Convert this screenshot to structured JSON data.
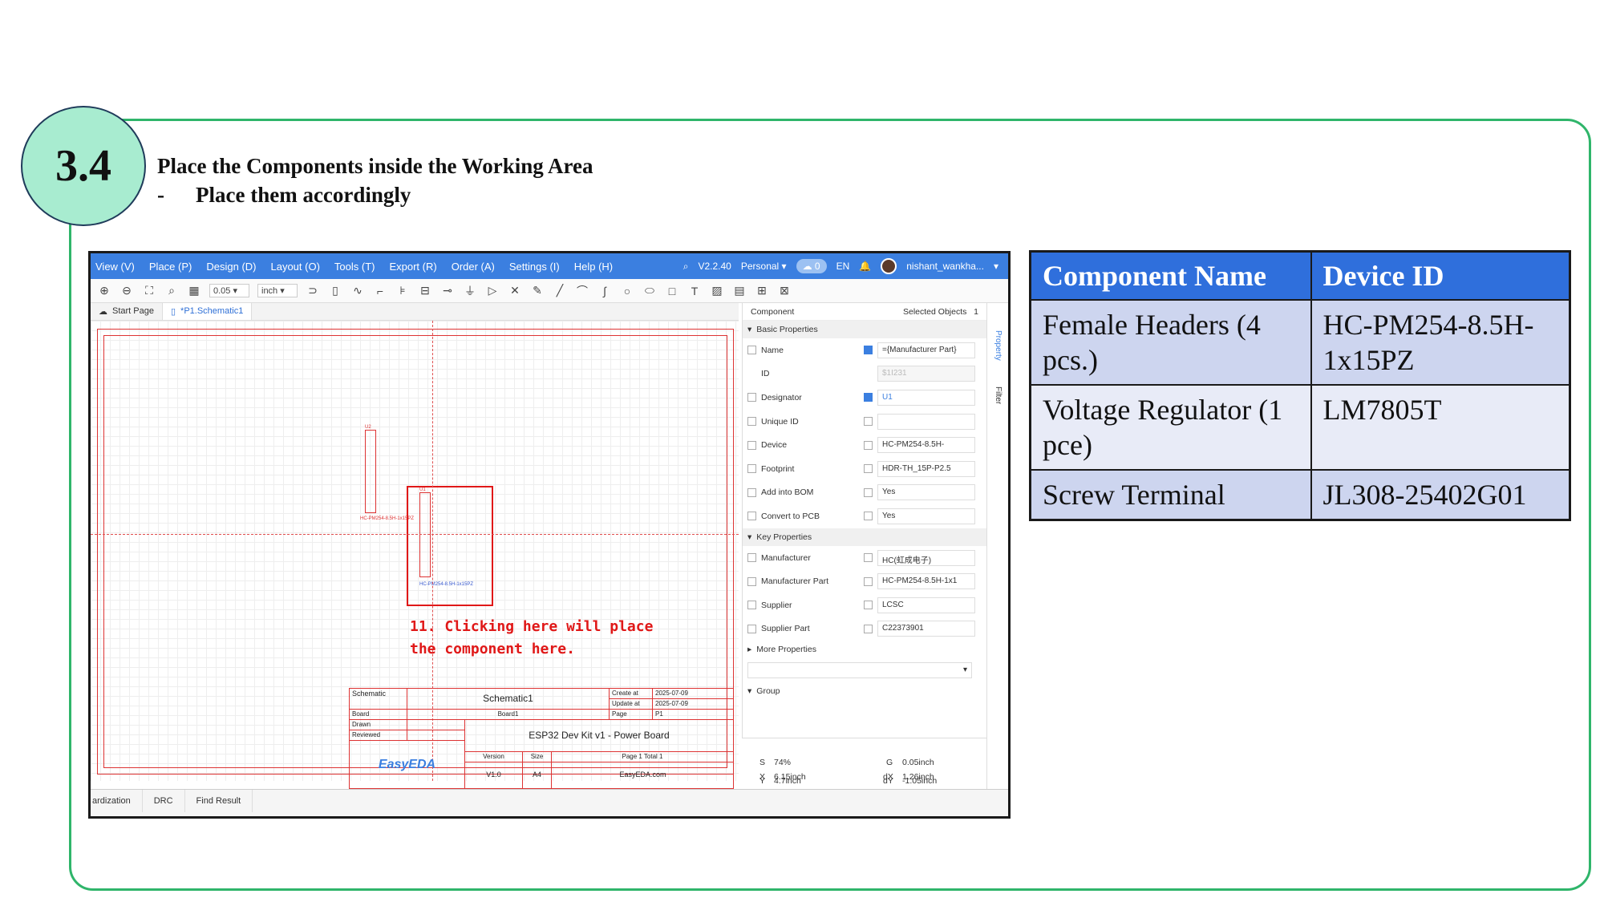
{
  "step": {
    "number": "3.4",
    "title": "Place the Components inside the Working Area",
    "bullet": "-",
    "subtitle": "Place them accordingly"
  },
  "app": {
    "menu": [
      "View (V)",
      "Place (P)",
      "Design (D)",
      "Layout (O)",
      "Tools (T)",
      "Export (R)",
      "Order (A)",
      "Settings (I)",
      "Help (H)"
    ],
    "version": "V2.2.40",
    "plan": "Personal",
    "cloud_count": "0",
    "language": "EN",
    "username": "nishant_wankha...",
    "toolbar": {
      "grid_value": "0.05",
      "unit": "inch"
    },
    "tabs": [
      {
        "label": "Start Page"
      },
      {
        "label": "*P1.Schematic1"
      }
    ],
    "canvas": {
      "part1_label": "HC-PM254-8.5H-1x15PZ",
      "part1_ref": "U1",
      "part2_label": "HC-PM254-8.5H-1x15PZ",
      "part2_ref": "U2",
      "annotation_line1": "11. Clicking here will place",
      "annotation_line2": "the component here."
    },
    "title_block": {
      "schematic_label": "Schematic",
      "schematic_value": "Schematic1",
      "create_label": "Create at",
      "create_value": "2025-07-09",
      "update_label": "Update at",
      "update_value": "2025-07-09",
      "board_label": "Board",
      "board_value": "Board1",
      "page_label": "Page",
      "page_value": "P1",
      "drawn_label": "Drawn",
      "reviewed_label": "Reviewed",
      "project_title": "ESP32 Dev Kit v1 - Power Board",
      "version_label": "Version",
      "version_value": "V1.0",
      "size_label": "Size",
      "size_value": "A4",
      "page_total": "Page  1  Total  1",
      "site": "EasyEDA.com",
      "logo": "EasyEDA"
    },
    "panel": {
      "header_left": "Component",
      "header_right": "Selected Objects",
      "selected_count": "1",
      "basic_section": "Basic Properties",
      "key_section": "Key Properties",
      "more_section": "More Properties",
      "group_section": "Group",
      "basic_rows": [
        {
          "name": "Name",
          "value": "={Manufacturer Part}",
          "checked": true
        },
        {
          "name": "ID",
          "value": "$1I231",
          "checked": false
        },
        {
          "name": "Designator",
          "value": "U1",
          "checked": true
        },
        {
          "name": "Unique ID",
          "value": "",
          "checked": false
        },
        {
          "name": "Device",
          "value": "HC-PM254-8.5H-",
          "checked": false
        },
        {
          "name": "Footprint",
          "value": "HDR-TH_15P-P2.5",
          "checked": false
        },
        {
          "name": "Add into BOM",
          "value": "Yes",
          "checked": false
        },
        {
          "name": "Convert to PCB",
          "value": "Yes",
          "checked": false
        }
      ],
      "key_rows": [
        {
          "name": "Manufacturer",
          "value": "HC(虹成电子)"
        },
        {
          "name": "Manufacturer Part",
          "value": "HC-PM254-8.5H-1x1"
        },
        {
          "name": "Supplier",
          "value": "LCSC"
        },
        {
          "name": "Supplier Part",
          "value": "C22373901"
        }
      ],
      "side_tabs": [
        "Property",
        "Filter"
      ],
      "coords": {
        "s_label": "S",
        "s_value": "74%",
        "g_label": "G",
        "g_value": "0.05inch",
        "x_label": "X",
        "x_value": "6.15inch",
        "dx_label": "dX",
        "dx_value": "1.26inch",
        "y_label": "Y",
        "y_value": "4.7inch",
        "dy_label": "dY",
        "dy_value": "-1.05inch"
      }
    },
    "bottom_tabs": [
      "ardization",
      "DRC",
      "Find Result"
    ]
  },
  "components_table": {
    "headers": [
      "Component Name",
      "Device ID"
    ],
    "rows": [
      {
        "name": "Female Headers (4 pcs.)",
        "device_id": "HC-PM254-8.5H-1x15PZ"
      },
      {
        "name": "Voltage Regulator (1 pce)",
        "device_id": "LM7805T"
      },
      {
        "name": "Screw Terminal",
        "device_id": "JL308-25402G01"
      }
    ]
  },
  "colors": {
    "frame_green": "#2fb56a",
    "circle_fill": "#a8ecd0",
    "table_header_blue": "#2f6fdc",
    "app_blue": "#3b7fe0",
    "annotation_red": "#e01818"
  }
}
